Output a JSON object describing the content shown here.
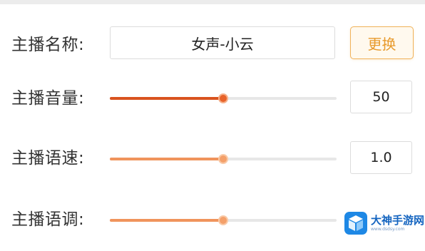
{
  "colors": {
    "accent_dark": "#d9531e",
    "accent_light": "#f0945c",
    "thumb_dark": "#e8632a",
    "thumb_light": "#f4a06a",
    "button_border": "#f0b25a",
    "button_text": "#e89a2c",
    "track": "#e7e7e7"
  },
  "anchor": {
    "name_label": "主播名称:",
    "name_value": "女声-小云",
    "change_button_label": "更换"
  },
  "volume": {
    "label": "主播音量:",
    "value_text": "50",
    "fraction": 0.5
  },
  "speed": {
    "label": "主播语速:",
    "value_text": "1.0",
    "fraction": 0.5
  },
  "pitch": {
    "label": "主播语调:",
    "fraction": 0.5
  },
  "watermark": {
    "title": "大神手游网",
    "url": "www.dsdsy.com",
    "icon": "cube-logo-icon"
  }
}
